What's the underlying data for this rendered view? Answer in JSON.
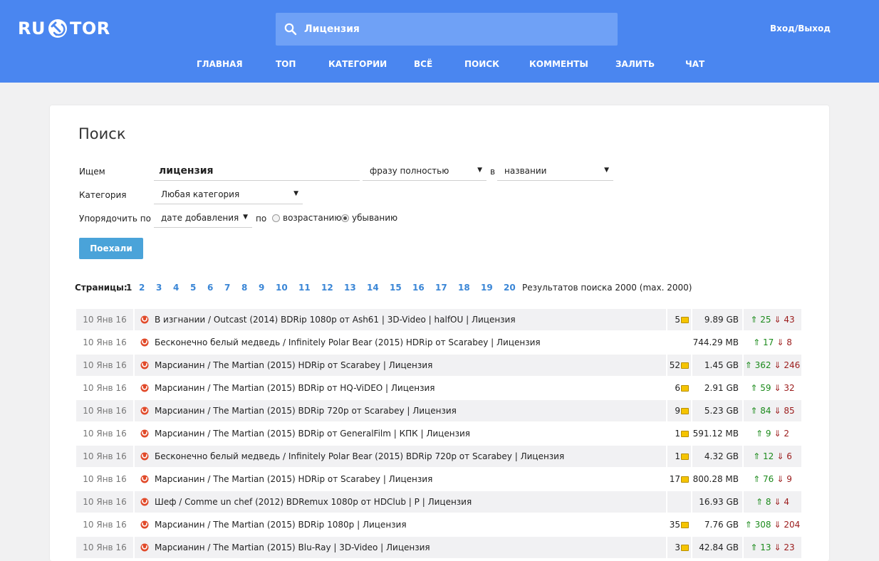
{
  "header": {
    "logo_left": "RU",
    "logo_right": "TOR",
    "search_value": "Лицензия",
    "login_label": "Вход/Выход",
    "nav": [
      "ГЛАВНАЯ",
      "ТОП",
      "КАТЕГОРИИ",
      "ВСЁ",
      "ПОИСК",
      "КОММЕНТЫ",
      "ЗАЛИТЬ",
      "ЧАТ"
    ]
  },
  "search_form": {
    "title": "Поиск",
    "query_label": "Ищем",
    "query_value": "лицензия",
    "mode_value": "фразу полностью",
    "in_label": "в",
    "scope_value": "названии",
    "category_label": "Категория",
    "category_value": "Любая категория",
    "order_label": "Упорядочить по",
    "order_value": "дате добавления",
    "by_label": "по",
    "asc_label": "возрастанию",
    "desc_label": "убыванию",
    "sort_selected": "desc",
    "submit_label": "Поехали"
  },
  "pagination": {
    "label": "Страницы:",
    "current": "1",
    "pages": [
      "2",
      "3",
      "4",
      "5",
      "6",
      "7",
      "8",
      "9",
      "10",
      "11",
      "12",
      "13",
      "14",
      "15",
      "16",
      "17",
      "18",
      "19",
      "20"
    ],
    "results_text": "Результатов поиска 2000 (max. 2000)"
  },
  "results": [
    {
      "date": "10 Янв 16",
      "title": "В изгнании / Outcast (2014) BDRip 1080p от Ash61 | 3D-Video | halfOU | Лицензия",
      "comments": "5",
      "size": "9.89 GB",
      "seeds": "25",
      "leeches": "43"
    },
    {
      "date": "10 Янв 16",
      "title": "Бесконечно белый медведь / Infinitely Polar Bear (2015) HDRip от Scarabey | Лицензия",
      "comments": "",
      "size": "744.29 MB",
      "seeds": "17",
      "leeches": "8"
    },
    {
      "date": "10 Янв 16",
      "title": "Марсианин / The Martian (2015) HDRip от Scarabey | Лицензия",
      "comments": "52",
      "size": "1.45 GB",
      "seeds": "362",
      "leeches": "246"
    },
    {
      "date": "10 Янв 16",
      "title": "Марсианин / The Martian (2015) BDRip от HQ-ViDEO | Лицензия",
      "comments": "6",
      "size": "2.91 GB",
      "seeds": "59",
      "leeches": "32"
    },
    {
      "date": "10 Янв 16",
      "title": "Марсианин / The Martian (2015) BDRip 720p от Scarabey | Лицензия",
      "comments": "9",
      "size": "5.23 GB",
      "seeds": "84",
      "leeches": "85"
    },
    {
      "date": "10 Янв 16",
      "title": "Марсианин / The Martian (2015) BDRip от GeneralFilm | КПК | Лицензия",
      "comments": "1",
      "size": "591.12 MB",
      "seeds": "9",
      "leeches": "2"
    },
    {
      "date": "10 Янв 16",
      "title": "Бесконечно белый медведь / Infinitely Polar Bear (2015) BDRip 720p от Scarabey | Лицензия",
      "comments": "1",
      "size": "4.32 GB",
      "seeds": "12",
      "leeches": "6"
    },
    {
      "date": "10 Янв 16",
      "title": "Марсианин / The Martian (2015) HDRip от Scarabey | Лицензия",
      "comments": "17",
      "size": "800.28 MB",
      "seeds": "76",
      "leeches": "9"
    },
    {
      "date": "10 Янв 16",
      "title": "Шеф / Comme un chef (2012) BDRemux 1080p от HDClub | P | Лицензия",
      "comments": "",
      "size": "16.93 GB",
      "seeds": "8",
      "leeches": "4"
    },
    {
      "date": "10 Янв 16",
      "title": "Марсианин / The Martian (2015) BDRip 1080p | Лицензия",
      "comments": "35",
      "size": "7.76 GB",
      "seeds": "308",
      "leeches": "204"
    },
    {
      "date": "10 Янв 16",
      "title": "Марсианин / The Martian (2015) Blu-Ray | 3D-Video | Лицензия",
      "comments": "3",
      "size": "42.84 GB",
      "seeds": "13",
      "leeches": "23"
    }
  ],
  "colors": {
    "header_bg": "#4a86f0",
    "search_bg": "#6fa1f6",
    "page_bg": "#f1f1f2",
    "button_bg": "#4aa3d9",
    "link": "#3a86d6",
    "seed": "#1b8a1b",
    "leech": "#9b1b1b",
    "comment_bubble": "#f5c400"
  },
  "icons": {
    "logo_mark": "hammer-sickle-icon",
    "search": "search-icon",
    "magnet": "magnet-icon",
    "comment": "comment-bubble-icon",
    "up": "arrow-up-icon",
    "down": "arrow-down-icon"
  }
}
